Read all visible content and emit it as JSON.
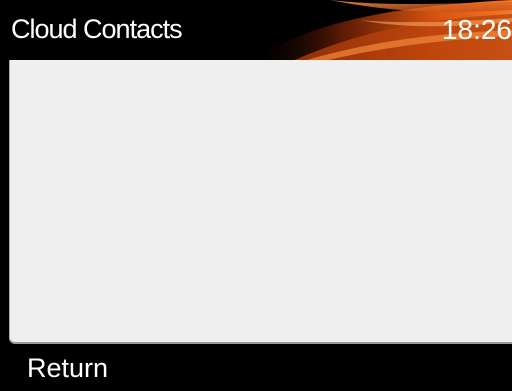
{
  "header": {
    "title": "Cloud Contacts",
    "time": "18:26"
  },
  "softkeys": {
    "left_label": "Return"
  },
  "colors": {
    "accent_orange": "#e8601a",
    "content_background": "#efefef",
    "bar_background": "#000000"
  }
}
